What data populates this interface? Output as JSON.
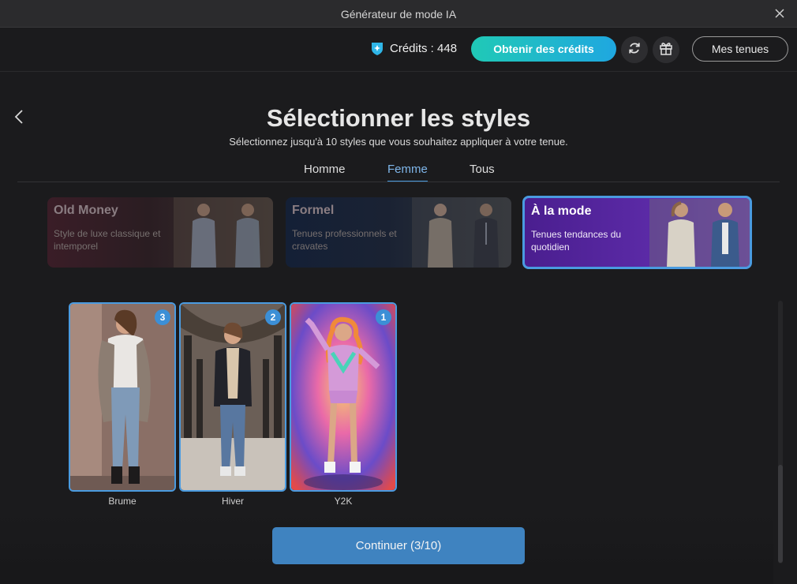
{
  "window": {
    "title": "Générateur de mode IA"
  },
  "topbar": {
    "credits_label": "Crédits : 448",
    "obtain_label": "Obtenir des crédits",
    "outfits_label": "Mes tenues",
    "icons": [
      "gem-icon",
      "refresh-icon",
      "gift-icon"
    ]
  },
  "header": {
    "title": "Sélectionner les styles",
    "subtitle": "Sélectionnez jusqu'à 10 styles que vous souhaitez appliquer à votre tenue."
  },
  "tabs": [
    {
      "label": "Homme",
      "active": false
    },
    {
      "label": "Femme",
      "active": true
    },
    {
      "label": "Tous",
      "active": false
    }
  ],
  "categories": [
    {
      "title": "Old Money",
      "description": "Style de luxe classique et intemporel",
      "selected": false
    },
    {
      "title": "Formel",
      "description": "Tenues professionnels et cravates",
      "selected": false
    },
    {
      "title": "À la mode",
      "description": "Tenues tendances du quotidien",
      "selected": true
    }
  ],
  "styles": [
    {
      "label": "Brume",
      "order": "3"
    },
    {
      "label": "Hiver",
      "order": "2"
    },
    {
      "label": "Y2K",
      "order": "1"
    }
  ],
  "continue_label": "Continuer (3/10)",
  "colors": {
    "accent": "#4a9be0",
    "obtain_gradient_start": "#20c9b6",
    "obtain_gradient_end": "#1fa7e0",
    "continue_bg": "#3f83c0",
    "selected_category_bg": "#5a2aa0"
  }
}
